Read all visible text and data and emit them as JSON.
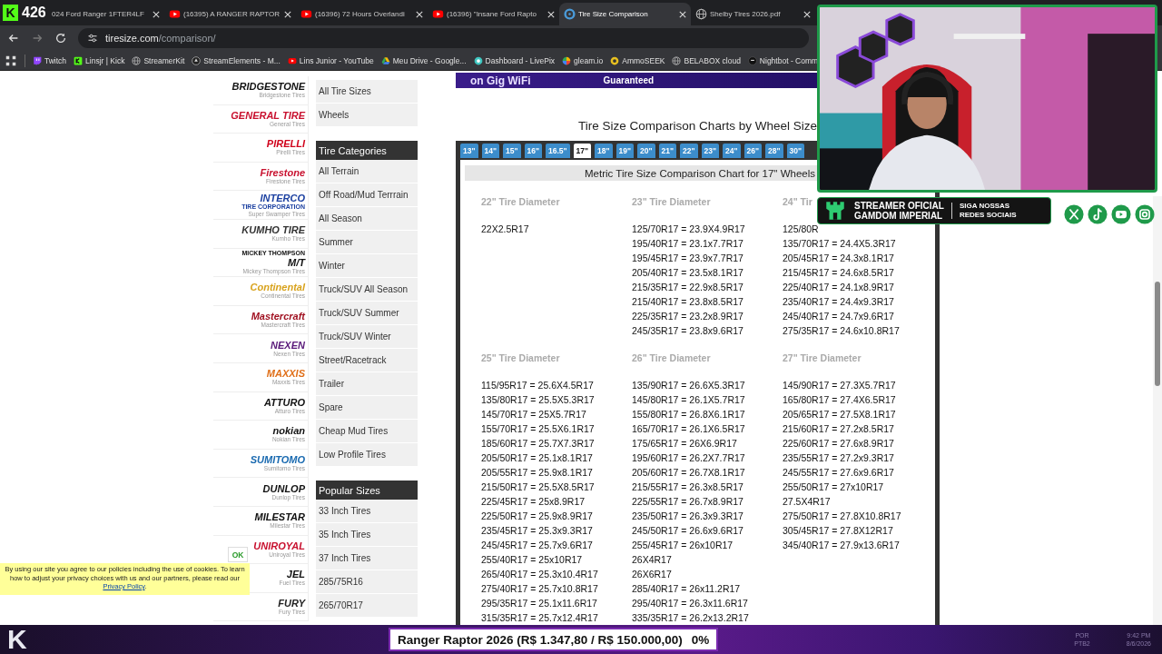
{
  "stream_overlay": {
    "counter_logo": "K",
    "counter": "426",
    "sponsor": {
      "line_1": "STREAMER OFICIAL",
      "line_2": "GAMDOM IMPERIAL",
      "follow_1": "SIGA NOSSAS",
      "follow_2": "REDES SOCIAIS"
    },
    "socials": [
      {
        "kind": "x"
      },
      {
        "kind": "tiktok"
      },
      {
        "kind": "youtube"
      },
      {
        "kind": "instagram"
      }
    ],
    "corner_logo": "K",
    "goal": {
      "label": "Ranger Raptor 2026 (R$ 1.347,80 / R$ 150.000,00)",
      "percent": "0%"
    },
    "tray": {
      "lang_1": "POR",
      "lang_2": "PTB2",
      "time": "9:42 PM",
      "date": "8/6/2026"
    }
  },
  "browser": {
    "tabs": [
      {
        "title": "024 Ford Ranger 1FTER4LF",
        "selected": false
      },
      {
        "title": "(16395) A RANGER RAPTOR",
        "kind": "youtube",
        "selected": false
      },
      {
        "title": "(16396) 72 Hours Overlandi",
        "kind": "youtube",
        "selected": false
      },
      {
        "title": "(16396) \"Insane Ford Rapto",
        "kind": "youtube",
        "selected": false
      },
      {
        "title": "Tire Size Comparison",
        "kind": "tire",
        "selected": true
      },
      {
        "title": "Shelby Tires 2026.pdf",
        "kind": "globe",
        "selected": false
      }
    ],
    "url": {
      "host": "tiresize.com",
      "path": "/comparison/"
    },
    "bookmarks": [
      {
        "label": "Twitch",
        "kind": "twitch"
      },
      {
        "label": "Linsjr | Kick",
        "kind": "kick"
      },
      {
        "label": "StreamerKit",
        "kind": "globe"
      },
      {
        "label": "StreamElements - M...",
        "kind": "streamelements"
      },
      {
        "label": "Lins Junior - YouTube",
        "kind": "youtube"
      },
      {
        "label": "Meu Drive - Google...",
        "kind": "drive"
      },
      {
        "label": "Dashboard - LivePix",
        "kind": "livepix"
      },
      {
        "label": "gleam.io",
        "kind": "gleam"
      },
      {
        "label": "AmmoSEEK",
        "kind": "ammoseek"
      },
      {
        "label": "BELABOX cloud",
        "kind": "globe"
      },
      {
        "label": "Nightbot - Comm",
        "kind": "nightbot"
      }
    ]
  },
  "page": {
    "ad_banner": {
      "headline": "on Gig WiFi",
      "tagline": "Guaranteed"
    },
    "brands": [
      {
        "logo": "BRIDGESTONE",
        "caption": "Bridgestone Tires",
        "color": "#111111"
      },
      {
        "logo": "GENERAL TIRE",
        "caption": "General Tires",
        "color": "#c8102e"
      },
      {
        "logo": "PIRELLI",
        "caption": "Pirelli Tires",
        "color": "#d0021b"
      },
      {
        "logo": "Firestone",
        "caption": "Firestone Tires",
        "color": "#c8102e"
      },
      {
        "logo": "INTERCO",
        "logo_below": "TIRE CORPORATION",
        "caption": "Super Swamper Tires",
        "color": "#1a3fa0"
      },
      {
        "logo": "KUMHO TIRE",
        "caption": "Kumho Tires",
        "color": "#333333"
      },
      {
        "logo": "M/T",
        "logo_above": "MICKEY THOMPSON",
        "caption": "Mickey Thompson Tires",
        "color": "#111111"
      },
      {
        "logo": "Continental",
        "caption": "Continental Tires",
        "color": "#d8a21c"
      },
      {
        "logo": "Mastercraft",
        "caption": "Mastercraft Tires",
        "color": "#a01020"
      },
      {
        "logo": "NEXEN",
        "caption": "Nexen Tires",
        "color": "#5a1a7a"
      },
      {
        "logo": "MAXXIS",
        "caption": "Maxxis Tires",
        "color": "#e0701a"
      },
      {
        "logo": "ATTURO",
        "caption": "Atturo Tires",
        "color": "#111111"
      },
      {
        "logo": "nokian",
        "caption": "Nokian Tires",
        "color": "#111111"
      },
      {
        "logo": "SUMITOMO",
        "caption": "Sumitomo Tires",
        "color": "#1a6ab0"
      },
      {
        "logo": "DUNLOP",
        "caption": "Dunlop Tires",
        "color": "#111111"
      },
      {
        "logo": "MILESTAR",
        "caption": "Milestar Tires",
        "color": "#111111"
      },
      {
        "logo": "UNIROYAL",
        "caption": "Uniroyal Tires",
        "color": "#c8102e"
      },
      {
        "logo": "JEL",
        "caption": "Fuel Tires",
        "color": "#111111"
      },
      {
        "logo": "FURY",
        "caption": "Fury Tires",
        "color": "#222222"
      }
    ],
    "menu_sections": [
      {
        "items": [
          "All Tire Sizes",
          "Wheels"
        ]
      },
      {
        "title": "Tire Categories",
        "items": [
          "All Terrain",
          "Off Road/Mud Terrrain",
          "All Season",
          "Summer",
          "Winter",
          "Truck/SUV All Season",
          "Truck/SUV Summer",
          "Truck/SUV Winter",
          "Street/Racetrack",
          "Trailer",
          "Spare",
          "Cheap Mud Tires",
          "Low Profile Tires"
        ]
      },
      {
        "title": "Popular Sizes",
        "items": [
          "33 Inch Tires",
          "35 Inch Tires",
          "37 Inch Tires",
          "285/75R16",
          "265/70R17"
        ]
      }
    ],
    "chart_heading": "Tire Size Comparison Charts by Wheel Size",
    "size_tabs": [
      {
        "label": "13\"",
        "selected": false
      },
      {
        "label": "14\"",
        "selected": false
      },
      {
        "label": "15\"",
        "selected": false
      },
      {
        "label": "16\"",
        "selected": false
      },
      {
        "label": "16.5\"",
        "selected": false
      },
      {
        "label": "17\"",
        "selected": true
      },
      {
        "label": "18\"",
        "selected": false
      },
      {
        "label": "19\"",
        "selected": false
      },
      {
        "label": "20\"",
        "selected": false
      },
      {
        "label": "21\"",
        "selected": false
      },
      {
        "label": "22\"",
        "selected": false
      },
      {
        "label": "23\"",
        "selected": false
      },
      {
        "label": "24\"",
        "selected": false
      },
      {
        "label": "26\"",
        "selected": false
      },
      {
        "label": "28\"",
        "selected": false
      },
      {
        "label": "30\"",
        "selected": false
      }
    ],
    "table_title": "Metric Tire Size Comparison Chart for 17\" Wheels",
    "diameter_groups": [
      {
        "heading": "22\" Tire Diameter",
        "sizes": [
          "22X2.5R17"
        ]
      },
      {
        "heading": "23\" Tire Diameter",
        "sizes": [
          "125/70R17 = 23.9X4.9R17",
          "195/40R17 = 23.1x7.7R17",
          "195/45R17 = 23.9x7.7R17",
          "205/40R17 = 23.5x8.1R17",
          "215/35R17 = 22.9x8.5R17",
          "215/40R17 = 23.8x8.5R17",
          "225/35R17 = 23.2x8.9R17",
          "245/35R17 = 23.8x9.6R17"
        ]
      },
      {
        "heading": "24\" Tir",
        "sizes": [
          "125/80R",
          "135/70R17 = 24.4X5.3R17",
          "205/45R17 = 24.3x8.1R17",
          "215/45R17 = 24.6x8.5R17",
          "225/40R17 = 24.1x8.9R17",
          "235/40R17 = 24.4x9.3R17",
          "245/40R17 = 24.7x9.6R17",
          "275/35R17 = 24.6x10.8R17"
        ]
      },
      {
        "heading": "25\" Tire Diameter",
        "sizes": [
          "115/95R17 = 25.6X4.5R17",
          "135/80R17 = 25.5X5.3R17",
          "145/70R17 = 25X5.7R17",
          "155/70R17 = 25.5X6.1R17",
          "185/60R17 = 25.7X7.3R17",
          "205/50R17 = 25.1x8.1R17",
          "205/55R17 = 25.9x8.1R17",
          "215/50R17 = 25.5X8.5R17",
          "225/45R17 = 25x8.9R17",
          "225/50R17 = 25.9x8.9R17",
          "235/45R17 = 25.3x9.3R17",
          "245/45R17 = 25.7x9.6R17",
          "255/40R17 = 25x10R17",
          "265/40R17 = 25.3x10.4R17",
          "275/40R17 = 25.7x10.8R17",
          "295/35R17 = 25.1x11.6R17",
          "315/35R17 = 25.7x12.4R17"
        ]
      },
      {
        "heading": "26\" Tire Diameter",
        "sizes": [
          "135/90R17 = 26.6X5.3R17",
          "145/80R17 = 26.1X5.7R17",
          "155/80R17 = 26.8X6.1R17",
          "165/70R17 = 26.1X6.5R17",
          "175/65R17 = 26X6.9R17",
          "195/60R17 = 26.2X7.7R17",
          "205/60R17 = 26.7X8.1R17",
          "215/55R17 = 26.3x8.5R17",
          "225/55R17 = 26.7x8.9R17",
          "235/50R17 = 26.3x9.3R17",
          "245/50R17 = 26.6x9.6R17",
          "255/45R17 = 26x10R17",
          "26X4R17",
          "26X6R17",
          "285/40R17 = 26x11.2R17",
          "295/40R17 = 26.3x11.6R17",
          "335/35R17 = 26.2x13.2R17"
        ]
      },
      {
        "heading": "27\" Tire Diameter",
        "sizes": [
          "145/90R17 = 27.3X5.7R17",
          "165/80R17 = 27.4X6.5R17",
          "205/65R17 = 27.5X8.1R17",
          "215/60R17 = 27.2x8.5R17",
          "225/60R17 = 27.6x8.9R17",
          "235/55R17 = 27.2x9.3R17",
          "245/55R17 = 27.6x9.6R17",
          "255/50R17 = 27x10R17",
          "27.5X4R17",
          "275/50R17 = 27.8X10.8R17",
          "305/45R17 = 27.8X12R17",
          "345/40R17 = 27.9x13.6R17"
        ]
      }
    ],
    "cookie_notice": {
      "text": "By using our site you agree to our policies including the use of cookies. To learn how to adjust your privacy choices with us and our partners, please read our",
      "link": "Privacy Policy",
      "after": ".",
      "button": "OK"
    }
  }
}
